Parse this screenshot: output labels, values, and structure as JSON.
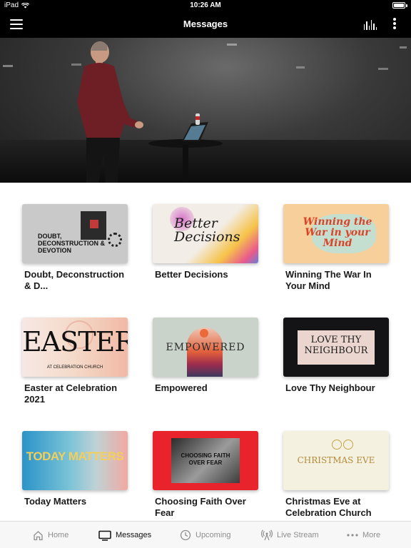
{
  "status_bar": {
    "device": "iPad",
    "time": "10:26 AM"
  },
  "nav": {
    "title": "Messages"
  },
  "messages": [
    {
      "title": "Doubt, Deconstruction & D...",
      "thumb_text": "DOUBT, DECONSTRUCTION & DEVOTION"
    },
    {
      "title": "Better Decisions",
      "thumb_text": "Better Decisions"
    },
    {
      "title": "Winning The War In Your Mind",
      "thumb_text": "Winning the War in your Mind"
    },
    {
      "title": "Easter at Celebration 2021",
      "thumb_text": "EASTER",
      "thumb_subtext": "AT CELEBRATION CHURCH"
    },
    {
      "title": "Empowered",
      "thumb_text": "EMPOWERED"
    },
    {
      "title": "Love Thy Neighbour",
      "thumb_text": "LOVE THY NEIGHBOUR"
    },
    {
      "title": "Today Matters",
      "thumb_text": "TODAY MATTERS"
    },
    {
      "title": "Choosing Faith Over Fear",
      "thumb_text": "CHOOSING FAITH OVER FEAR"
    },
    {
      "title": "Christmas Eve at Celebration Church",
      "thumb_text": "CHRISTMAS EVE"
    }
  ],
  "tabs": [
    {
      "label": "Home",
      "icon": "home-icon"
    },
    {
      "label": "Messages",
      "icon": "tv-icon"
    },
    {
      "label": "Upcoming",
      "icon": "clock-icon"
    },
    {
      "label": "Live Stream",
      "icon": "broadcast-icon"
    },
    {
      "label": "More",
      "icon": "ellipsis-icon"
    }
  ],
  "colors": {
    "bar": "#000000",
    "tab_active": "#111111",
    "tab_inactive": "#8e8e8e"
  }
}
